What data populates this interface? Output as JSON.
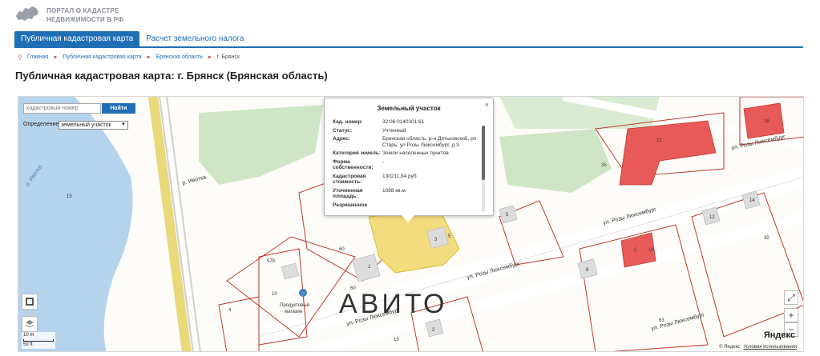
{
  "header": {
    "portal_title_line1": "ПОРТАЛ О КАДАСТРЕ",
    "portal_title_line2": "НЕДВИЖИМОСТИ В РФ",
    "tabs": [
      {
        "label": "Публичная кадастровая карта",
        "active": true
      },
      {
        "label": "Расчет земельного налога",
        "active": false
      }
    ]
  },
  "breadcrumb": [
    "Главная",
    "Публичная кадастровая карта",
    "Брянская область",
    "г. Брянск"
  ],
  "page_title": "Публичная кадастровая карта: г. Брянск (Брянская область)",
  "map": {
    "search_placeholder": "кадастровый номер",
    "search_button": "Найти",
    "mode_label": "Определение",
    "mode_value": "земельный участок",
    "scale_top": "10 m",
    "scale_bottom": "50 ft",
    "yandex_brand": "Яндекс",
    "attribution_copy": "© Яндекс",
    "attribution_link": "Условия использования",
    "watermark": "АВИТО",
    "street_labels": [
      "ул. Розы Люксембург",
      "ул. Розы Люксембург",
      "ул. Розы Люксембург",
      "ул. Розы Люксембург",
      "ул. Розы Люксембург"
    ],
    "area_labels": [
      "р. Ивотка",
      "р. Ивотка"
    ],
    "poi_label_1": "Продуктовый",
    "poi_label_2": "магазин",
    "parcel_numbers": [
      "15",
      "60",
      "60",
      "1",
      "3",
      "5",
      "5",
      "8",
      "10",
      "63",
      "12",
      "14",
      "30",
      "2",
      "13"
    ],
    "building_numbers": [
      "35",
      "12",
      "18",
      "2",
      "10",
      "12",
      "3",
      "5",
      "1",
      "57б",
      "4"
    ],
    "accent_color": "#1f6fb6",
    "highlight_color": "#f3dc7e",
    "building_color": "#e85a5a"
  },
  "popup": {
    "title": "Земельный участок",
    "rows": [
      {
        "key": "Кад. номер:",
        "value": "32:06:0140301:61"
      },
      {
        "key": "Статус:",
        "value": "Учтенный"
      },
      {
        "key": "Адрес:",
        "value": "Брянская область, р-н Дятьковский, рп Старь, ул Розы Люксембург, д 3"
      },
      {
        "key": "Категория земель:",
        "value": "Земли населенных пунктов"
      },
      {
        "key": "Форма собственности:",
        "value": "-"
      },
      {
        "key": "Кадастровая стоимость:",
        "value": "130211.84 руб"
      },
      {
        "key": "Уточненная площадь:",
        "value": "1088 кв.м"
      },
      {
        "key": "Разрешенное",
        "value": ""
      }
    ]
  }
}
